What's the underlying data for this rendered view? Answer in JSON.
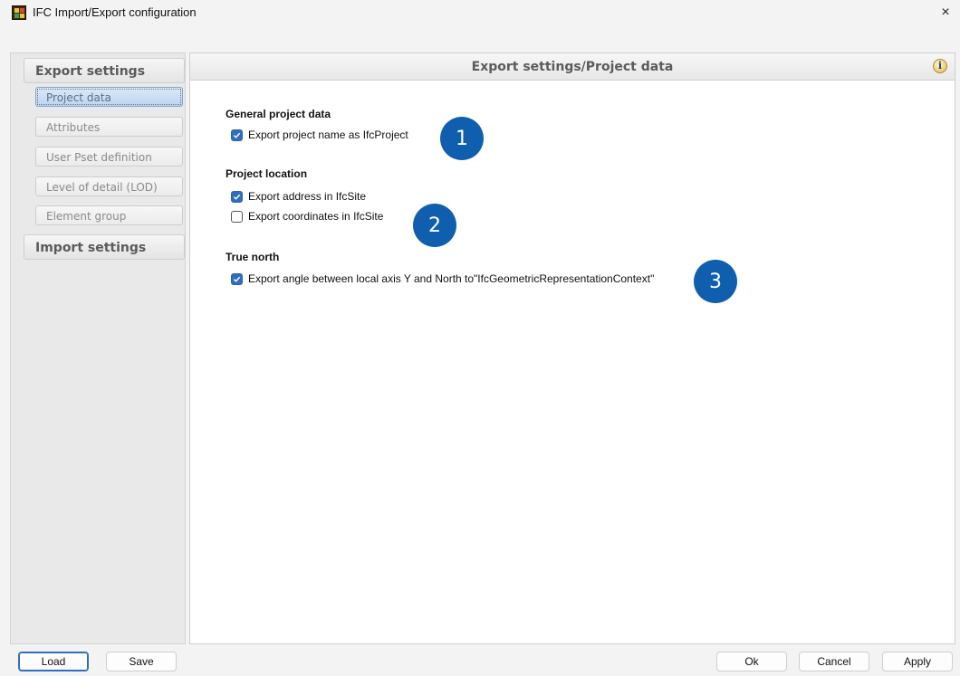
{
  "window": {
    "title": "IFC Import/Export configuration",
    "close_glyph": "×",
    "app_icon": "ifc-app-icon"
  },
  "sidebar": {
    "export_header": "Export settings",
    "items": [
      {
        "label": "Project data",
        "active": true
      },
      {
        "label": "Attributes",
        "active": false
      },
      {
        "label": "User Pset definition",
        "active": false
      },
      {
        "label": "Level of detail (LOD)",
        "active": false
      },
      {
        "label": "Element group",
        "active": false
      }
    ],
    "import_header": "Import settings"
  },
  "main": {
    "header": "Export settings/Project data",
    "info_glyph": "i",
    "groups": {
      "general": {
        "title": "General project data",
        "options": [
          {
            "label": "Export project name as IfcProject",
            "checked": true
          }
        ]
      },
      "location": {
        "title": "Project location",
        "options": [
          {
            "label": "Export address in IfcSite",
            "checked": true
          },
          {
            "label": "Export coordinates in IfcSite",
            "checked": false
          }
        ]
      },
      "north": {
        "title": "True north",
        "options": [
          {
            "label": "Export angle between local axis Y and North to\"IfcGeometricRepresentationContext\"",
            "checked": true
          }
        ]
      }
    },
    "badges": [
      "1",
      "2",
      "3"
    ]
  },
  "footer": {
    "load": "Load",
    "save": "Save",
    "ok": "Ok",
    "cancel": "Cancel",
    "apply": "Apply"
  },
  "colors": {
    "accent": "#2f6fbd",
    "badge": "#0f5fae",
    "active_item": "#bcd5ef"
  }
}
